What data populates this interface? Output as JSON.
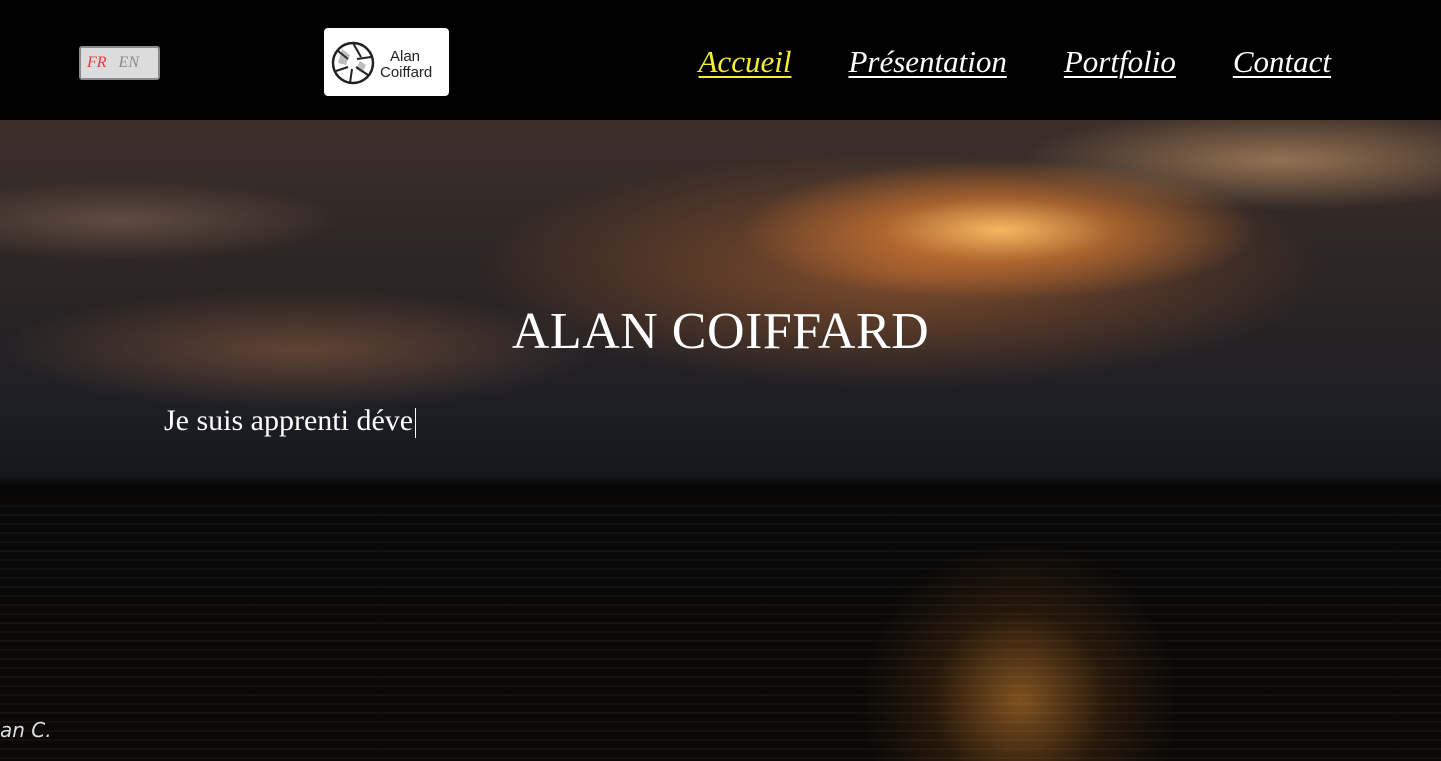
{
  "header": {
    "lang": {
      "fr": "FR",
      "en": "EN"
    },
    "logo": {
      "line1": "Alan",
      "line2": "Coiffard",
      "icon": "camera-aperture-icon"
    },
    "nav": [
      {
        "label": "Accueil",
        "active": true
      },
      {
        "label": "Présentation",
        "active": false
      },
      {
        "label": "Portfolio",
        "active": false
      },
      {
        "label": "Contact",
        "active": false
      }
    ]
  },
  "hero": {
    "title": "ALAN COIFFARD",
    "typed_text": "Je suis apprenti déve",
    "watermark": "an C."
  },
  "colors": {
    "header_bg": "#000000",
    "nav_active": "#f7ee2d",
    "nav_default": "#ffffff",
    "lang_active": "#e63a3a",
    "lang_inactive": "#8a8a8a"
  }
}
